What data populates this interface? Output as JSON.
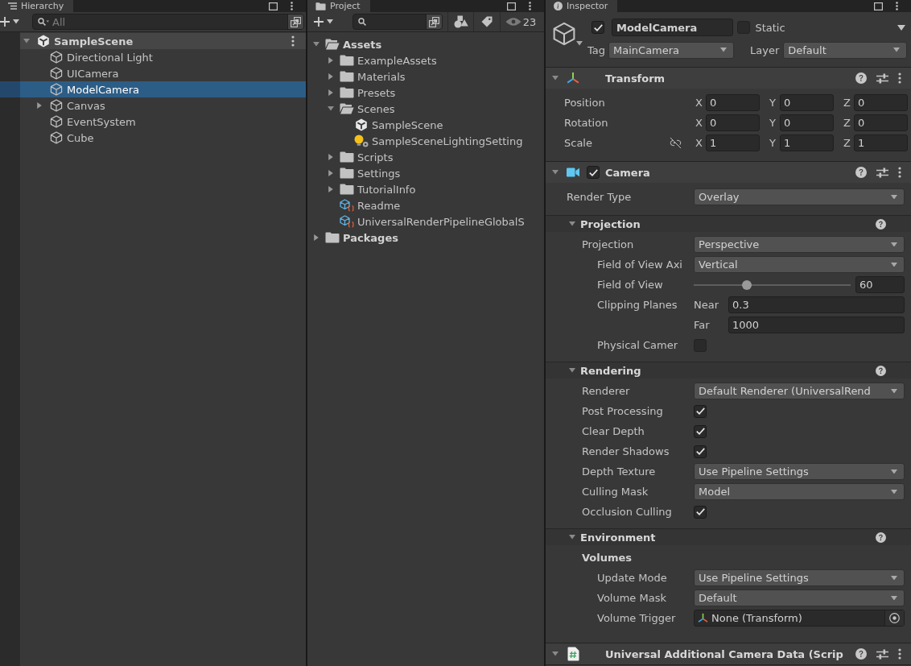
{
  "hierarchy": {
    "tab": "Hierarchy",
    "search": {
      "placeholder": "All"
    },
    "scene": {
      "name": "SampleScene",
      "expanded": true,
      "children": [
        {
          "name": "Directional Light",
          "selected": false
        },
        {
          "name": "UICamera",
          "selected": false
        },
        {
          "name": "ModelCamera",
          "selected": true
        },
        {
          "name": "Canvas",
          "expanded": false,
          "selected": false
        },
        {
          "name": "EventSystem",
          "selected": false
        },
        {
          "name": "Cube",
          "selected": false
        }
      ]
    }
  },
  "project": {
    "tab": "Project",
    "hidden_count": "23",
    "tree": [
      {
        "name": "Assets",
        "kind": "folder",
        "expanded": true,
        "children": [
          {
            "name": "ExampleAssets",
            "kind": "folder",
            "expanded": false
          },
          {
            "name": "Materials",
            "kind": "folder",
            "expanded": false
          },
          {
            "name": "Presets",
            "kind": "folder",
            "expanded": false
          },
          {
            "name": "Scenes",
            "kind": "folder",
            "expanded": true,
            "children": [
              {
                "name": "SampleScene",
                "kind": "scene"
              },
              {
                "name": "SampleSceneLightingSetting",
                "kind": "lighting"
              }
            ]
          },
          {
            "name": "Scripts",
            "kind": "folder",
            "expanded": false
          },
          {
            "name": "Settings",
            "kind": "folder",
            "expanded": false
          },
          {
            "name": "TutorialInfo",
            "kind": "folder",
            "expanded": false
          },
          {
            "name": "Readme",
            "kind": "asset"
          },
          {
            "name": "UniversalRenderPipelineGlobalS",
            "kind": "asset"
          }
        ]
      },
      {
        "name": "Packages",
        "kind": "folder",
        "expanded": false
      }
    ]
  },
  "inspector": {
    "tab": "Inspector",
    "object": {
      "active": true,
      "name": "ModelCamera",
      "static": false,
      "static_label": "Static",
      "tag_label": "Tag",
      "tag": "MainCamera",
      "layer_label": "Layer",
      "layer": "Default"
    },
    "components": [
      {
        "kind": "transform",
        "title": "Transform",
        "expanded": true,
        "vectors": [
          {
            "label": "Position",
            "axes": [
              {
                "axis": "X",
                "value": "0"
              },
              {
                "axis": "Y",
                "value": "0"
              },
              {
                "axis": "Z",
                "value": "0"
              }
            ]
          },
          {
            "label": "Rotation",
            "axes": [
              {
                "axis": "X",
                "value": "0"
              },
              {
                "axis": "Y",
                "value": "0"
              },
              {
                "axis": "Z",
                "value": "0"
              }
            ]
          },
          {
            "label": "Scale",
            "proportions_linked": false,
            "axes": [
              {
                "axis": "X",
                "value": "1"
              },
              {
                "axis": "Y",
                "value": "1"
              },
              {
                "axis": "Z",
                "value": "1"
              }
            ]
          }
        ]
      },
      {
        "kind": "camera",
        "title": "Camera",
        "enabled": true,
        "expanded": true,
        "properties": [
          {
            "kind": "dropdown",
            "label": "Render Type",
            "value": "Overlay"
          }
        ],
        "sections": [
          {
            "title": "Projection",
            "expanded": true,
            "properties": [
              {
                "kind": "dropdown",
                "label": "Projection",
                "value": "Perspective",
                "children": [
                  {
                    "kind": "dropdown",
                    "label": "Field of View Axi",
                    "value": "Vertical"
                  },
                  {
                    "kind": "slider",
                    "label": "Field of View",
                    "level": 0.33,
                    "value": "60"
                  },
                  {
                    "kind": "range",
                    "label": "Clipping Planes",
                    "fields": [
                      {
                        "label": "Near",
                        "value": "0.3"
                      },
                      {
                        "label": "Far",
                        "value": "1000"
                      }
                    ]
                  },
                  {
                    "kind": "checkbox",
                    "label": "Physical Camer",
                    "checked": false
                  }
                ]
              }
            ]
          },
          {
            "title": "Rendering",
            "expanded": true,
            "properties": [
              {
                "kind": "dropdown",
                "label": "Renderer",
                "value": "Default Renderer (UniversalRend"
              },
              {
                "kind": "checkbox",
                "label": "Post Processing",
                "checked": true
              },
              {
                "kind": "checkbox",
                "label": "Clear Depth",
                "checked": true
              },
              {
                "kind": "checkbox",
                "label": "Render Shadows",
                "checked": true
              },
              {
                "kind": "dropdown",
                "label": "Depth Texture",
                "value": "Use Pipeline Settings"
              },
              {
                "kind": "dropdown",
                "label": "Culling Mask",
                "value": "Model"
              },
              {
                "kind": "checkbox",
                "label": "Occlusion Culling",
                "checked": true
              }
            ]
          },
          {
            "title": "Environment",
            "expanded": true,
            "properties": [
              {
                "kind": "heading",
                "label": "Volumes",
                "children": [
                  {
                    "kind": "dropdown",
                    "label": "Update Mode",
                    "value": "Use Pipeline Settings"
                  },
                  {
                    "kind": "dropdown",
                    "label": "Volume Mask",
                    "value": "Default"
                  },
                  {
                    "kind": "object",
                    "label": "Volume Trigger",
                    "value": "None (Transform)"
                  }
                ]
              }
            ]
          }
        ]
      },
      {
        "kind": "script",
        "title": "Universal Additional Camera Data (Scrip",
        "expanded": true
      }
    ]
  }
}
